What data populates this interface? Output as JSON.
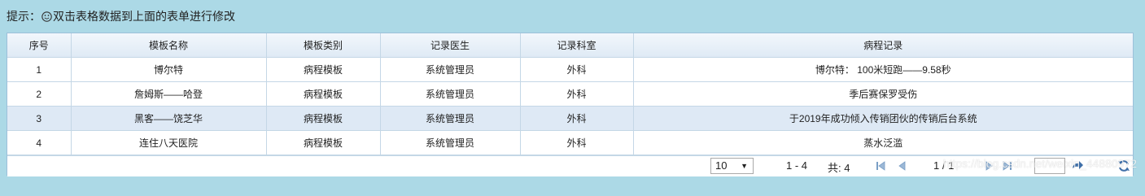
{
  "tip": {
    "prefix": "提示：",
    "text": "双击表格数据到上面的表单进行修改"
  },
  "table": {
    "columns": [
      "序号",
      "模板名称",
      "模板类别",
      "记录医生",
      "记录科室",
      "病程记录"
    ],
    "rows": [
      [
        "1",
        "博尔特",
        "病程模板",
        "系统管理员",
        "外科",
        "博尔特： 100米短跑——9.58秒"
      ],
      [
        "2",
        "詹姆斯——哈登",
        "病程模板",
        "系统管理员",
        "外科",
        "季后赛保罗受伤"
      ],
      [
        "3",
        "黑客——饶芝华",
        "病程模板",
        "系统管理员",
        "外科",
        "于2019年成功倾入传销团伙的传销后台系统"
      ],
      [
        "4",
        "连住八天医院",
        "病程模板",
        "系统管理员",
        "外科",
        "蒸水泛滥"
      ]
    ]
  },
  "pager": {
    "page_size": "10",
    "range": "1 - 4",
    "total": "共: 4",
    "page_no": "1 / 1",
    "page_input": ""
  },
  "icons": {
    "tip": "smile-icon",
    "first": "first-page-icon",
    "prev": "prev-page-icon",
    "next": "next-page-icon",
    "last": "last-page-icon",
    "go": "go-arrow-icon",
    "refresh": "refresh-icon"
  },
  "watermark": "https://blog.csdn.net/weixin_44880972"
}
